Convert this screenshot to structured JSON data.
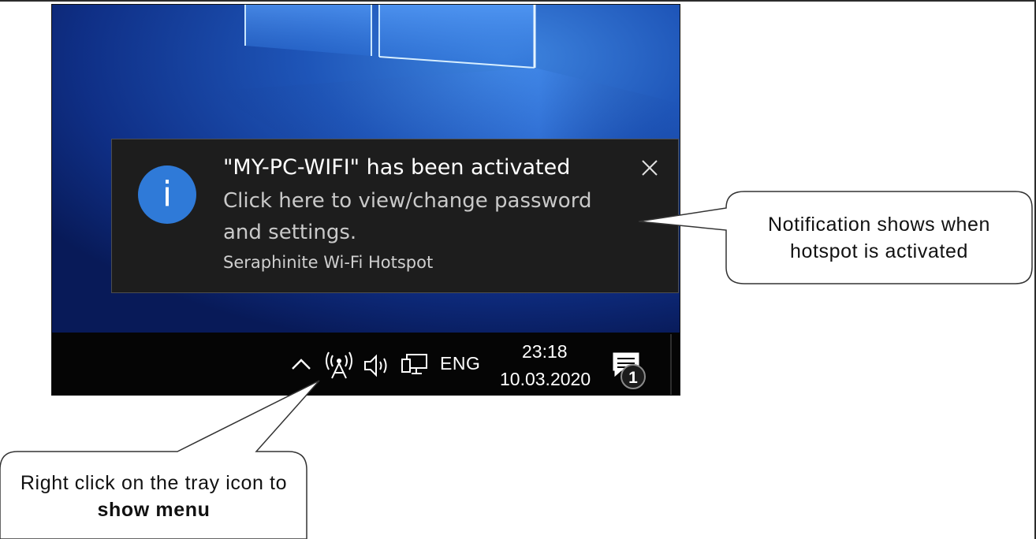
{
  "notification": {
    "title": "\"MY-PC-WIFI\" has been activated",
    "body": "Click here to view/change password and settings.",
    "source": "Seraphinite Wi-Fi Hotspot",
    "icon": "info-icon",
    "icon_glyph": "i",
    "close_icon": "close-icon",
    "accent": "#2f7ad8"
  },
  "taskbar": {
    "language": "ENG",
    "time": "23:18",
    "date": "10.03.2020",
    "notification_count": "1",
    "icons": [
      "chevron-up-icon",
      "hotspot-tray-icon",
      "volume-icon",
      "network-icon",
      "action-center-icon"
    ]
  },
  "callouts": {
    "notification_note": "Notification shows when hotspot is activated",
    "tray_note_prefix": "Right click on the tray icon to",
    "tray_note_bold": "show menu"
  }
}
